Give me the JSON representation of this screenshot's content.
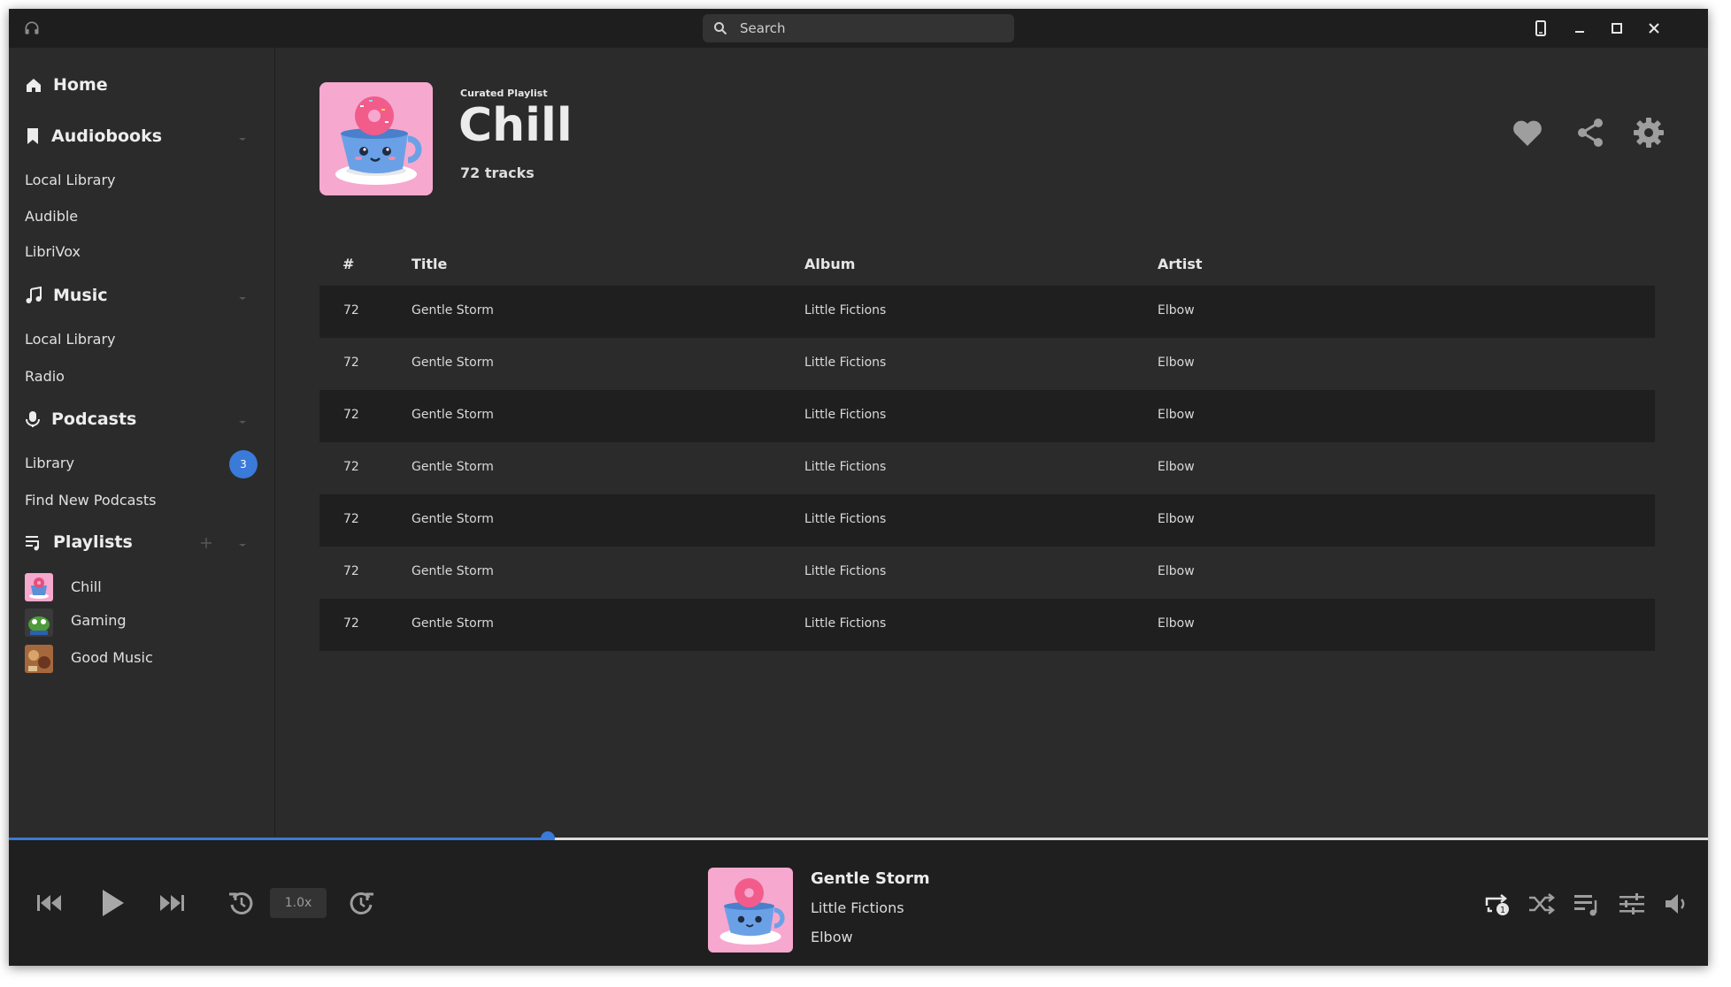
{
  "search": {
    "placeholder": "Search"
  },
  "sidebar": {
    "home": "Home",
    "audiobooks": {
      "label": "Audiobooks",
      "items": [
        "Local Library",
        "Audible",
        "LibriVox"
      ]
    },
    "music": {
      "label": "Music",
      "items": [
        "Local Library",
        "Radio"
      ]
    },
    "podcasts": {
      "label": "Podcasts",
      "items": [
        "Library",
        "Find New Podcasts"
      ],
      "library_badge": "3"
    },
    "playlists": {
      "label": "Playlists",
      "items": [
        "Chill",
        "Gaming",
        "Good Music"
      ]
    }
  },
  "playlist": {
    "eyebrow": "Curated Playlist",
    "title": "Chill",
    "count": "72 tracks"
  },
  "table": {
    "headers": [
      "#",
      "Title",
      "Album",
      "Artist"
    ],
    "rows": [
      [
        "72",
        "Gentle Storm",
        "Little Fictions",
        "Elbow"
      ],
      [
        "72",
        "Gentle Storm",
        "Little Fictions",
        "Elbow"
      ],
      [
        "72",
        "Gentle Storm",
        "Little Fictions",
        "Elbow"
      ],
      [
        "72",
        "Gentle Storm",
        "Little Fictions",
        "Elbow"
      ],
      [
        "72",
        "Gentle Storm",
        "Little Fictions",
        "Elbow"
      ],
      [
        "72",
        "Gentle Storm",
        "Little Fictions",
        "Elbow"
      ],
      [
        "72",
        "Gentle Storm",
        "Little Fictions",
        "Elbow"
      ]
    ]
  },
  "player": {
    "progress": 0.317,
    "speed": "1.0x",
    "title": "Gentle Storm",
    "album": "Little Fictions",
    "artist": "Elbow"
  },
  "colors": {
    "accent": "#3a7ad8",
    "cover_bg": "#f7a8cf"
  },
  "icons": [
    "headphones-icon",
    "search-icon",
    "phone-icon",
    "minimize-icon",
    "maximize-icon",
    "close-icon",
    "home-icon",
    "bookmark-icon",
    "music-note-icon",
    "microphone-icon",
    "playlist-icon",
    "heart-icon",
    "share-icon",
    "gear-icon",
    "skip-previous-icon",
    "play-icon",
    "skip-next-icon",
    "rewind-icon",
    "forward-icon",
    "repeat-one-icon",
    "shuffle-icon",
    "queue-icon",
    "equalizer-icon",
    "volume-icon"
  ]
}
